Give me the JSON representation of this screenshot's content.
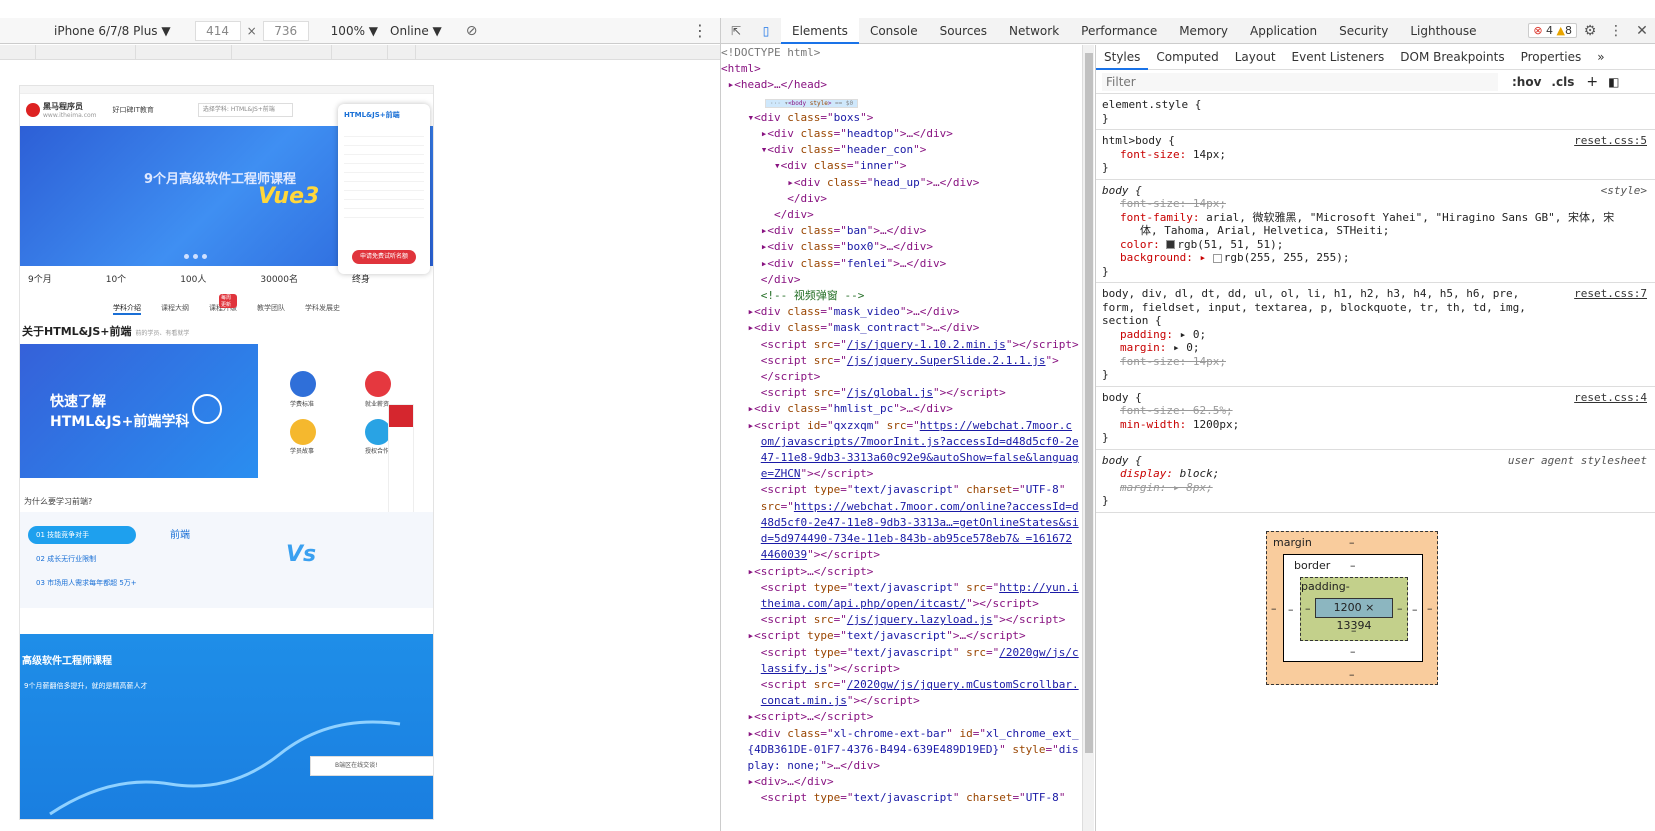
{
  "device_toolbar": {
    "device": "iPhone 6/7/8 Plus ▼",
    "width": "414",
    "height": "736",
    "times": "×",
    "zoom": "100% ▼",
    "network": "Online ▼"
  },
  "page": {
    "logo_text": "黑马程序员",
    "logo_sub": "www.itheima.com",
    "edu": "好口碑IT教育",
    "select_label": "选择学科:",
    "select_value": "HTML&JS+前端",
    "banner_line1": "9个月高级软件工程师课程",
    "banner_line2": "Vue3",
    "side_card_title": "HTML&JS+前端",
    "side_card_cta": "申请免费试听名额",
    "stats": [
      "9个月",
      "10个",
      "100人",
      "30000名",
      "终身"
    ],
    "nav": [
      "学科介绍",
      "课程大纲",
      "课程升级",
      "教学团队",
      "学科发展史"
    ],
    "nav_badge": "每周更新",
    "about_title": "关于HTML&JS+前端",
    "about_sub": "前的学员、有看就学",
    "video_line1": "快速了解",
    "video_line2": "HTML&JS+前端学科",
    "icon_labels": [
      "学费标准",
      "就业薪资",
      "学员故事",
      "授权合作"
    ],
    "why_title": "为什么要学习前端?",
    "compare_items": [
      "01 技能竞争对手",
      "02 成长无行业限制",
      "03 市场用人需求每年都超 5万+"
    ],
    "compare_right_title": "前端",
    "vs": "Vs",
    "course_title": "高级软件工程师课程",
    "course_sub": "9个月薪翻倍多提升，就的是精高薪人才",
    "chat_label": "B端区在线交谈!"
  },
  "devtools": {
    "tabs": [
      "Elements",
      "Console",
      "Sources",
      "Network",
      "Performance",
      "Memory",
      "Application",
      "Security",
      "Lighthouse"
    ],
    "active_tab": "Elements",
    "errors": "4",
    "warnings": "8",
    "styles_tabs": [
      "Styles",
      "Computed",
      "Layout",
      "Event Listeners",
      "DOM Breakpoints",
      "Properties"
    ],
    "filter_placeholder": "Filter",
    "hov": ":hov",
    "cls": ".cls",
    "box_model": {
      "margin": "margin",
      "border": "border",
      "padding": "padding-",
      "content": "1200 × 13394",
      "dash": "–"
    },
    "rules": [
      {
        "selector": "element.style {",
        "source": ""
      },
      {
        "selector": "html>body {",
        "source": "reset.css:5"
      },
      {
        "selector": "body {",
        "source": "<style>"
      },
      {
        "selector": "body, div, dl, dt, dd, ul, ol, li, h1, h2, h3, h4, h5, h6, pre, form, fieldset, input, textarea, p, blockquote, tr, th, td, img, section {",
        "source": "reset.css:7"
      },
      {
        "selector": "body {",
        "source": "reset.css:4"
      },
      {
        "selector": "body {",
        "source": "user agent stylesheet"
      }
    ]
  }
}
